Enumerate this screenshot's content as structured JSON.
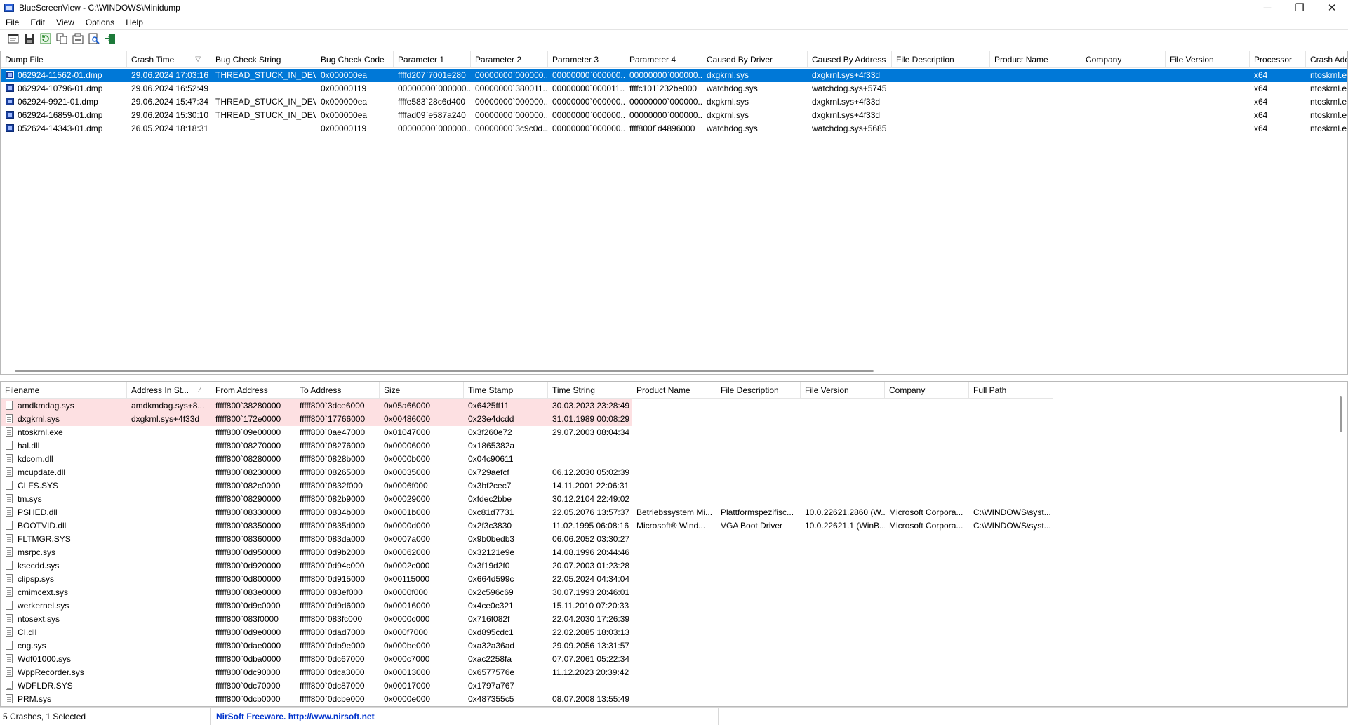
{
  "window": {
    "title": "BlueScreenView  -  C:\\WINDOWS\\Minidump",
    "controls": {
      "minimize": "─",
      "maximize": "❐",
      "close": "✕"
    }
  },
  "menu": [
    "File",
    "Edit",
    "View",
    "Options",
    "Help"
  ],
  "toolbar": [
    {
      "icon": "properties-icon"
    },
    {
      "icon": "save-icon"
    },
    {
      "icon": "refresh-icon"
    },
    {
      "icon": "copy-icon"
    },
    {
      "icon": "advanced-options-icon"
    },
    {
      "icon": "find-icon"
    },
    {
      "icon": "exit-icon"
    }
  ],
  "crash_list": {
    "columns": [
      {
        "label": "Dump File",
        "width": 180
      },
      {
        "label": "Crash Time",
        "width": 120,
        "sort": "▽"
      },
      {
        "label": "Bug Check String",
        "width": 150
      },
      {
        "label": "Bug Check Code",
        "width": 110
      },
      {
        "label": "Parameter 1",
        "width": 110
      },
      {
        "label": "Parameter 2",
        "width": 110
      },
      {
        "label": "Parameter 3",
        "width": 110
      },
      {
        "label": "Parameter 4",
        "width": 110
      },
      {
        "label": "Caused By Driver",
        "width": 150
      },
      {
        "label": "Caused By Address",
        "width": 120
      },
      {
        "label": "File Description",
        "width": 140
      },
      {
        "label": "Product Name",
        "width": 130
      },
      {
        "label": "Company",
        "width": 120
      },
      {
        "label": "File Version",
        "width": 120
      },
      {
        "label": "Processor",
        "width": 80
      },
      {
        "label": "Crash Address",
        "width": 70
      }
    ],
    "rows": [
      {
        "selected": true,
        "cells": [
          "062924-11562-01.dmp",
          "29.06.2024 17:03:16",
          "THREAD_STUCK_IN_DEV...",
          "0x000000ea",
          "ffffd207`7001e280",
          "00000000`000000...",
          "00000000`000000...",
          "00000000`000000...",
          "dxgkrnl.sys",
          "dxgkrnl.sys+4f33d",
          "",
          "",
          "",
          "",
          "x64",
          "ntoskrnl.exe"
        ]
      },
      {
        "selected": false,
        "cells": [
          "062924-10796-01.dmp",
          "29.06.2024 16:52:49",
          "",
          "0x00000119",
          "00000000`000000...",
          "00000000`380011...",
          "00000000`000011...",
          "ffffc101`232be000",
          "watchdog.sys",
          "watchdog.sys+5745",
          "",
          "",
          "",
          "",
          "x64",
          "ntoskrnl.exe"
        ]
      },
      {
        "selected": false,
        "cells": [
          "062924-9921-01.dmp",
          "29.06.2024 15:47:34",
          "THREAD_STUCK_IN_DEV...",
          "0x000000ea",
          "ffffe583`28c6d400",
          "00000000`000000...",
          "00000000`000000...",
          "00000000`000000...",
          "dxgkrnl.sys",
          "dxgkrnl.sys+4f33d",
          "",
          "",
          "",
          "",
          "x64",
          "ntoskrnl.exe"
        ]
      },
      {
        "selected": false,
        "cells": [
          "062924-16859-01.dmp",
          "29.06.2024 15:30:10",
          "THREAD_STUCK_IN_DEV...",
          "0x000000ea",
          "ffffad09`e587a240",
          "00000000`000000...",
          "00000000`000000...",
          "00000000`000000...",
          "dxgkrnl.sys",
          "dxgkrnl.sys+4f33d",
          "",
          "",
          "",
          "",
          "x64",
          "ntoskrnl.exe"
        ]
      },
      {
        "selected": false,
        "cells": [
          "052624-14343-01.dmp",
          "26.05.2024 18:18:31",
          "",
          "0x00000119",
          "00000000`000000...",
          "00000000`3c9c0d...",
          "00000000`000000...",
          "ffff800f`d4896000",
          "watchdog.sys",
          "watchdog.sys+5685",
          "",
          "",
          "",
          "",
          "x64",
          "ntoskrnl.exe"
        ]
      }
    ]
  },
  "driver_list": {
    "columns": [
      {
        "label": "Filename",
        "width": 180
      },
      {
        "label": "Address In St...",
        "width": 120,
        "sort": "⁄"
      },
      {
        "label": "From Address",
        "width": 120
      },
      {
        "label": "To Address",
        "width": 120
      },
      {
        "label": "Size",
        "width": 120
      },
      {
        "label": "Time Stamp",
        "width": 120
      },
      {
        "label": "Time String",
        "width": 120
      },
      {
        "label": "Product Name",
        "width": 120
      },
      {
        "label": "File Description",
        "width": 120
      },
      {
        "label": "File Version",
        "width": 120
      },
      {
        "label": "Company",
        "width": 120
      },
      {
        "label": "Full Path",
        "width": 120
      }
    ],
    "rows": [
      {
        "highlight": true,
        "cells": [
          "amdkmdag.sys",
          "amdkmdag.sys+8...",
          "fffff800`38280000",
          "fffff800`3dce6000",
          "0x05a66000",
          "0x6425ff11",
          "30.03.2023 23:28:49",
          "",
          "",
          "",
          "",
          ""
        ]
      },
      {
        "highlight": true,
        "cells": [
          "dxgkrnl.sys",
          "dxgkrnl.sys+4f33d",
          "fffff800`172e0000",
          "fffff800`17766000",
          "0x00486000",
          "0x23e4dcdd",
          "31.01.1989 00:08:29",
          "",
          "",
          "",
          "",
          ""
        ]
      },
      {
        "highlight": false,
        "cells": [
          "ntoskrnl.exe",
          "",
          "fffff800`09e00000",
          "fffff800`0ae47000",
          "0x01047000",
          "0x3f260e72",
          "29.07.2003 08:04:34",
          "",
          "",
          "",
          "",
          ""
        ]
      },
      {
        "highlight": false,
        "cells": [
          "hal.dll",
          "",
          "fffff800`08270000",
          "fffff800`08276000",
          "0x00006000",
          "0x1865382a",
          "",
          "",
          "",
          "",
          "",
          ""
        ]
      },
      {
        "highlight": false,
        "cells": [
          "kdcom.dll",
          "",
          "fffff800`08280000",
          "fffff800`0828b000",
          "0x0000b000",
          "0x04c90611",
          "",
          "",
          "",
          "",
          "",
          ""
        ]
      },
      {
        "highlight": false,
        "cells": [
          "mcupdate.dll",
          "",
          "fffff800`08230000",
          "fffff800`08265000",
          "0x00035000",
          "0x729aefcf",
          "06.12.2030 05:02:39",
          "",
          "",
          "",
          "",
          ""
        ]
      },
      {
        "highlight": false,
        "cells": [
          "CLFS.SYS",
          "",
          "fffff800`082c0000",
          "fffff800`0832f000",
          "0x0006f000",
          "0x3bf2cec7",
          "14.11.2001 22:06:31",
          "",
          "",
          "",
          "",
          ""
        ]
      },
      {
        "highlight": false,
        "cells": [
          "tm.sys",
          "",
          "fffff800`08290000",
          "fffff800`082b9000",
          "0x00029000",
          "0xfdec2bbe",
          "30.12.2104 22:49:02",
          "",
          "",
          "",
          "",
          ""
        ]
      },
      {
        "highlight": false,
        "cells": [
          "PSHED.dll",
          "",
          "fffff800`08330000",
          "fffff800`0834b000",
          "0x0001b000",
          "0xc81d7731",
          "22.05.2076 13:57:37",
          "Betriebssystem Mi...",
          "Plattformspezifisc...",
          "10.0.22621.2860 (W...",
          "Microsoft Corpora...",
          "C:\\WINDOWS\\syst..."
        ]
      },
      {
        "highlight": false,
        "cells": [
          "BOOTVID.dll",
          "",
          "fffff800`08350000",
          "fffff800`0835d000",
          "0x0000d000",
          "0x2f3c3830",
          "11.02.1995 06:08:16",
          "Microsoft® Wind...",
          "VGA Boot Driver",
          "10.0.22621.1 (WinB...",
          "Microsoft Corpora...",
          "C:\\WINDOWS\\syst..."
        ]
      },
      {
        "highlight": false,
        "cells": [
          "FLTMGR.SYS",
          "",
          "fffff800`08360000",
          "fffff800`083da000",
          "0x0007a000",
          "0x9b0bedb3",
          "06.06.2052 03:30:27",
          "",
          "",
          "",
          "",
          ""
        ]
      },
      {
        "highlight": false,
        "cells": [
          "msrpc.sys",
          "",
          "fffff800`0d950000",
          "fffff800`0d9b2000",
          "0x00062000",
          "0x32121e9e",
          "14.08.1996 20:44:46",
          "",
          "",
          "",
          "",
          ""
        ]
      },
      {
        "highlight": false,
        "cells": [
          "ksecdd.sys",
          "",
          "fffff800`0d920000",
          "fffff800`0d94c000",
          "0x0002c000",
          "0x3f19d2f0",
          "20.07.2003 01:23:28",
          "",
          "",
          "",
          "",
          ""
        ]
      },
      {
        "highlight": false,
        "cells": [
          "clipsp.sys",
          "",
          "fffff800`0d800000",
          "fffff800`0d915000",
          "0x00115000",
          "0x664d599c",
          "22.05.2024 04:34:04",
          "",
          "",
          "",
          "",
          ""
        ]
      },
      {
        "highlight": false,
        "cells": [
          "cmimcext.sys",
          "",
          "fffff800`083e0000",
          "fffff800`083ef000",
          "0x0000f000",
          "0x2c596c69",
          "30.07.1993 20:46:01",
          "",
          "",
          "",
          "",
          ""
        ]
      },
      {
        "highlight": false,
        "cells": [
          "werkernel.sys",
          "",
          "fffff800`0d9c0000",
          "fffff800`0d9d6000",
          "0x00016000",
          "0x4ce0c321",
          "15.11.2010 07:20:33",
          "",
          "",
          "",
          "",
          ""
        ]
      },
      {
        "highlight": false,
        "cells": [
          "ntosext.sys",
          "",
          "fffff800`083f0000",
          "fffff800`083fc000",
          "0x0000c000",
          "0x716f082f",
          "22.04.2030 17:26:39",
          "",
          "",
          "",
          "",
          ""
        ]
      },
      {
        "highlight": false,
        "cells": [
          "CI.dll",
          "",
          "fffff800`0d9e0000",
          "fffff800`0dad7000",
          "0x000f7000",
          "0xd895cdc1",
          "22.02.2085 18:03:13",
          "",
          "",
          "",
          "",
          ""
        ]
      },
      {
        "highlight": false,
        "cells": [
          "cng.sys",
          "",
          "fffff800`0dae0000",
          "fffff800`0db9e000",
          "0x000be000",
          "0xa32a36ad",
          "29.09.2056 13:31:57",
          "",
          "",
          "",
          "",
          ""
        ]
      },
      {
        "highlight": false,
        "cells": [
          "Wdf01000.sys",
          "",
          "fffff800`0dba0000",
          "fffff800`0dc67000",
          "0x000c7000",
          "0xac2258fa",
          "07.07.2061 05:22:34",
          "",
          "",
          "",
          "",
          ""
        ]
      },
      {
        "highlight": false,
        "cells": [
          "WppRecorder.sys",
          "",
          "fffff800`0dc90000",
          "fffff800`0dca3000",
          "0x00013000",
          "0x6577576e",
          "11.12.2023 20:39:42",
          "",
          "",
          "",
          "",
          ""
        ]
      },
      {
        "highlight": false,
        "cells": [
          "WDFLDR.SYS",
          "",
          "fffff800`0dc70000",
          "fffff800`0dc87000",
          "0x00017000",
          "0x1797a767",
          "",
          "",
          "",
          "",
          "",
          ""
        ]
      },
      {
        "highlight": false,
        "cells": [
          "PRM.sys",
          "",
          "fffff800`0dcb0000",
          "fffff800`0dcbe000",
          "0x0000e000",
          "0x487355c5",
          "08.07.2008 13:55:49",
          "",
          "",
          "",
          "",
          ""
        ]
      }
    ]
  },
  "status": {
    "count": "5 Crashes, 1 Selected",
    "credit": "NirSoft Freeware.  http://www.nirsoft.net"
  },
  "colors": {
    "selection": "#0078d7",
    "highlight": "#fde0e2",
    "credit_link": "#0033cc"
  }
}
